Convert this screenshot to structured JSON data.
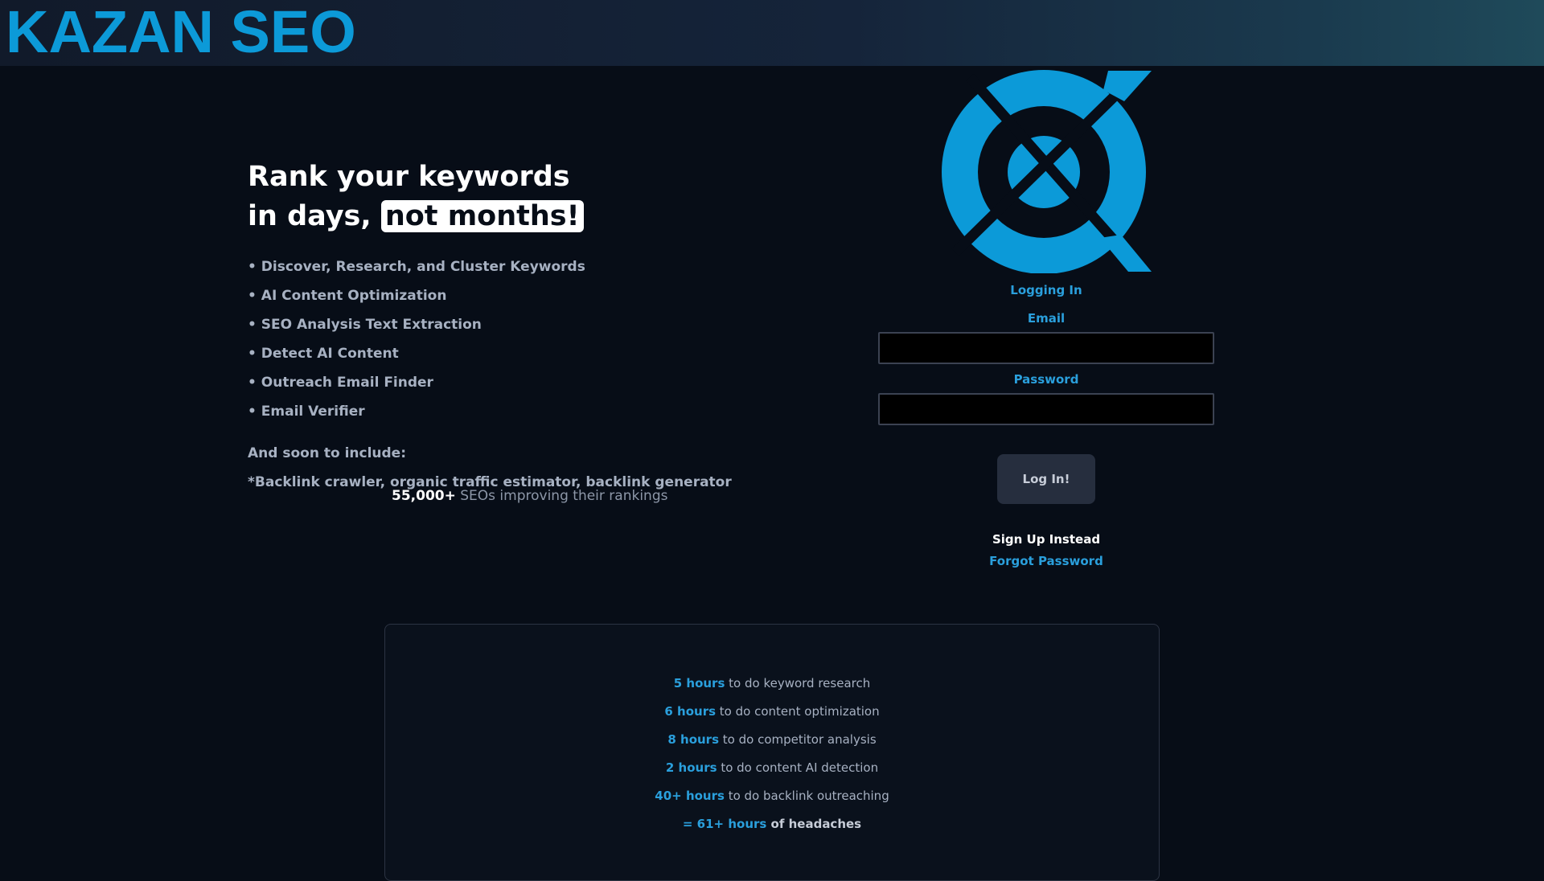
{
  "header": {
    "brand": "KAZAN SEO",
    "brand_color": "#0c9ad8"
  },
  "hero": {
    "headline_line1": "Rank your keywords",
    "headline_line2_prefix": "in days,",
    "headline_highlight": "not months!",
    "features": [
      "• Discover, Research, and Cluster Keywords",
      "• AI Content Optimization",
      "• SEO Analysis Text Extraction",
      "• Detect AI Content",
      "• Outreach Email Finder",
      "• Email Verifier"
    ],
    "soon_label": "And soon to include:",
    "soon_list": "*Backlink crawler, organic traffic estimator, backlink generator",
    "social_count": "55,000+",
    "social_text": " SEOs improving their rankings"
  },
  "logo": {
    "icon": "kazan-logo-icon",
    "color": "#0c9ad8"
  },
  "login": {
    "title": "Logging In",
    "email_label": "Email",
    "email_value": "",
    "password_label": "Password",
    "password_value": "",
    "submit_label": "Log In!",
    "signup_label": "Sign Up Instead",
    "forgot_label": "Forgot Password"
  },
  "stats": {
    "rows": [
      {
        "hours": "5 hours",
        "text": " to do keyword research"
      },
      {
        "hours": "6 hours",
        "text": " to do content optimization"
      },
      {
        "hours": "8 hours",
        "text": " to do competitor analysis"
      },
      {
        "hours": "2 hours",
        "text": " to do content AI detection"
      },
      {
        "hours": "40+ hours",
        "text": " to do backlink outreaching"
      }
    ],
    "total_hours": "= 61+ hours",
    "total_text": " of headaches"
  },
  "colors": {
    "background": "#070d17",
    "accent": "#2a9fdc",
    "muted_text": "#a7b1c2"
  }
}
